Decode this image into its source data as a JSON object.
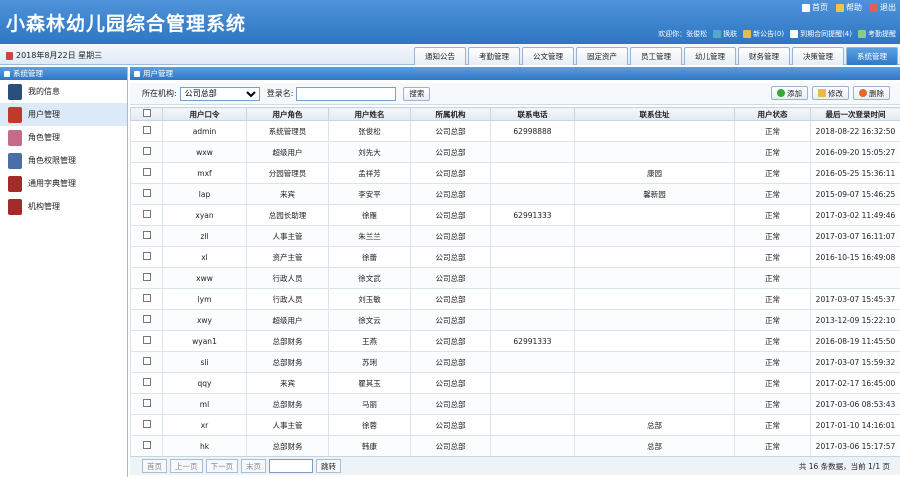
{
  "app_title": "小森林幼儿园综合管理系统",
  "top_links": [
    {
      "icon": "home-icon",
      "label": "首页"
    },
    {
      "icon": "help-icon",
      "label": "帮助"
    },
    {
      "icon": "exit-icon",
      "label": "退出"
    }
  ],
  "user_bar": {
    "welcome": "欢迎你：张俊松",
    "links": [
      {
        "icon": "switch-icon",
        "label": "换肤"
      },
      {
        "icon": "notice-icon",
        "label": "新公告(0)"
      },
      {
        "icon": "contract-icon",
        "label": "到期合同提醒(4)"
      },
      {
        "icon": "attendance-icon",
        "label": "考勤提醒"
      }
    ]
  },
  "date": "2018年8月22日 星期三",
  "tabs": [
    "通知公告",
    "考勤管理",
    "公文管理",
    "固定资产",
    "员工管理",
    "幼儿管理",
    "财务管理",
    "决策管理",
    "系统管理"
  ],
  "active_tab": 8,
  "sidebar": {
    "title": "系统管理",
    "items": [
      {
        "label": "我的信息",
        "icon": "user-icon"
      },
      {
        "label": "用户管理",
        "icon": "users-icon"
      },
      {
        "label": "角色管理",
        "icon": "role-icon"
      },
      {
        "label": "角色权限管理",
        "icon": "permission-icon"
      },
      {
        "label": "通用字典管理",
        "icon": "dictionary-icon"
      },
      {
        "label": "机构管理",
        "icon": "org-icon"
      }
    ],
    "active": 1
  },
  "main": {
    "title": "用户管理",
    "org_label": "所在机构:",
    "org_value": "公司总部",
    "login_label": "登录名:",
    "login_value": "",
    "search": "搜索",
    "add": "添加",
    "edit": "修改",
    "delete": "删除"
  },
  "columns": [
    "用户口令",
    "用户角色",
    "用户姓名",
    "所属机构",
    "联系电话",
    "联系住址",
    "用户状态",
    "最后一次登录时间"
  ],
  "rows": [
    [
      "admin",
      "系统管理员",
      "张俊松",
      "公司总部",
      "62998888",
      "",
      "正常",
      "2018-08-22 16:32:50"
    ],
    [
      "wxw",
      "超级用户",
      "刘先大",
      "公司总部",
      "",
      "",
      "正常",
      "2016-09-20 15:05:27"
    ],
    [
      "mxf",
      "分园管理员",
      "孟祥芳",
      "公司总部",
      "",
      "康园",
      "正常",
      "2016-05-25 15:36:11"
    ],
    [
      "lap",
      "来宾",
      "李安平",
      "公司总部",
      "",
      "馨新园",
      "正常",
      "2015-09-07 15:46:25"
    ],
    [
      "xyan",
      "总园长助理",
      "徐雁",
      "公司总部",
      "62991333",
      "",
      "正常",
      "2017-03-02 11:49:46"
    ],
    [
      "zll",
      "人事主管",
      "朱兰兰",
      "公司总部",
      "",
      "",
      "正常",
      "2017-03-07 16:11:07"
    ],
    [
      "xl",
      "资产主管",
      "徐蕾",
      "公司总部",
      "",
      "",
      "正常",
      "2016-10-15 16:49:08"
    ],
    [
      "xww",
      "行政人员",
      "徐文武",
      "公司总部",
      "",
      "",
      "正常",
      ""
    ],
    [
      "lym",
      "行政人员",
      "刘玉敏",
      "公司总部",
      "",
      "",
      "正常",
      "2017-03-07 15:45:37"
    ],
    [
      "xwy",
      "超级用户",
      "徐文云",
      "公司总部",
      "",
      "",
      "正常",
      "2013-12-09 15:22:10"
    ],
    [
      "wyan1",
      "总部财务",
      "王燕",
      "公司总部",
      "62991333",
      "",
      "正常",
      "2016-08-19 11:45:50"
    ],
    [
      "sli",
      "总部财务",
      "苏琍",
      "公司总部",
      "",
      "",
      "正常",
      "2017-03-07 15:59:32"
    ],
    [
      "qqy",
      "来宾",
      "瞿其玉",
      "公司总部",
      "",
      "",
      "正常",
      "2017-02-17 16:45:00"
    ],
    [
      "ml",
      "总部财务",
      "马丽",
      "公司总部",
      "",
      "",
      "正常",
      "2017-03-06 08:53:43"
    ],
    [
      "xr",
      "人事主管",
      "徐蓉",
      "公司总部",
      "",
      "总部",
      "正常",
      "2017-01-10 14:16:01"
    ],
    [
      "hk",
      "总部财务",
      "韩康",
      "公司总部",
      "",
      "总部",
      "正常",
      "2017-03-06 15:17:57"
    ]
  ],
  "pager": {
    "first": "首页",
    "prev": "上一页",
    "next": "下一页",
    "last": "末页",
    "go": "跳转",
    "info": "共 16 条数据，当前 1/1 页"
  },
  "colors": {
    "header": "#2e76c4",
    "accent": "#4e93d8",
    "active_row": "#dce9f7"
  }
}
